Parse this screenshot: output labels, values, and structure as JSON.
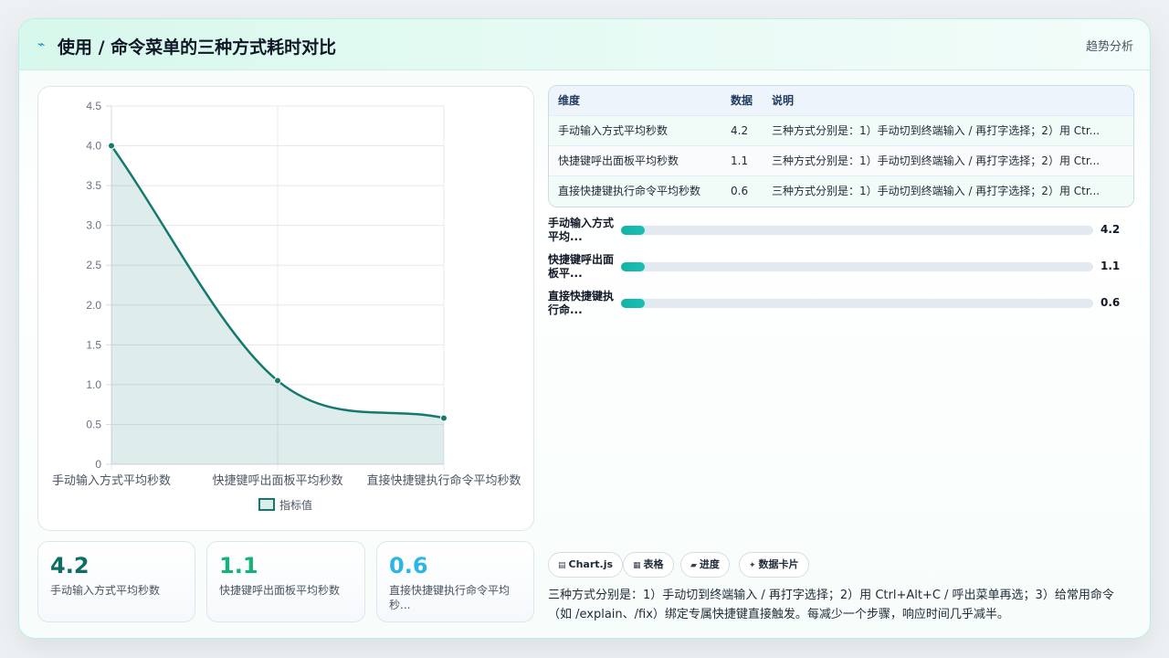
{
  "header": {
    "icon": "sparkle-icon",
    "title": "使用 / 命令菜单的三种方式耗时对比",
    "tag": "趋势分析"
  },
  "chart_data": {
    "type": "line",
    "categories": [
      "手动输入方式平均秒数",
      "快捷键呼出面板平均秒数",
      "直接快捷键执行命令平均秒数"
    ],
    "series": [
      {
        "name": "指标值",
        "values": [
          4.0,
          1.05,
          0.58
        ]
      }
    ],
    "yticks": [
      "0",
      "0.5",
      "1.0",
      "1.5",
      "2.0",
      "2.5",
      "3.0",
      "3.5",
      "4.0",
      "4.5"
    ],
    "ylim": [
      0,
      4.5
    ],
    "fill": true,
    "smooth": true,
    "grid": true,
    "legend": "bottom",
    "color": "#157a6e"
  },
  "stats": [
    {
      "value": "4.2",
      "label": "手动输入方式平均秒数",
      "color": "#0f6e63"
    },
    {
      "value": "1.1",
      "label": "快捷键呼出面板平均秒数",
      "color": "#19b17a"
    },
    {
      "value": "0.6",
      "label": "直接快捷键执行命令平均秒...",
      "color": "#2bb6e6"
    }
  ],
  "table": {
    "headers": [
      "维度",
      "数据",
      "说明"
    ],
    "rows": [
      [
        "手动输入方式平均秒数",
        "4.2",
        "三种方式分别是：1）手动切到终端输入 / 再打字选择；2）用 Ctr..."
      ],
      [
        "快捷键呼出面板平均秒数",
        "1.1",
        "三种方式分别是：1）手动切到终端输入 / 再打字选择；2）用 Ctr..."
      ],
      [
        "直接快捷键执行命令平均秒数",
        "0.6",
        "三种方式分别是：1）手动切到终端输入 / 再打字选择；2）用 Ctr..."
      ]
    ]
  },
  "progress": [
    {
      "label": "手动输入方式平均...",
      "value": "4.2",
      "fraction": 0.05
    },
    {
      "label": "快捷键呼出面板平...",
      "value": "1.1",
      "fraction": 0.05
    },
    {
      "label": "直接快捷键执行命...",
      "value": "0.6",
      "fraction": 0.05
    }
  ],
  "pills": [
    {
      "icon": "chart-icon",
      "glyph": "▤",
      "label": "Chart.js"
    },
    {
      "icon": "table-icon",
      "glyph": "▦",
      "label": "表格"
    },
    {
      "icon": "progress-icon",
      "glyph": "▰",
      "label": "进度"
    },
    {
      "icon": "card-icon",
      "glyph": "✦",
      "label": "数据卡片"
    }
  ],
  "note": "三种方式分别是：1）手动切到终端输入 / 再打字选择；2）用 Ctrl+Alt+C / 呼出菜单再选；3）给常用命令（如 /explain、/fix）绑定专属快捷键直接触发。每减少一个步骤，响应时间几乎减半。"
}
